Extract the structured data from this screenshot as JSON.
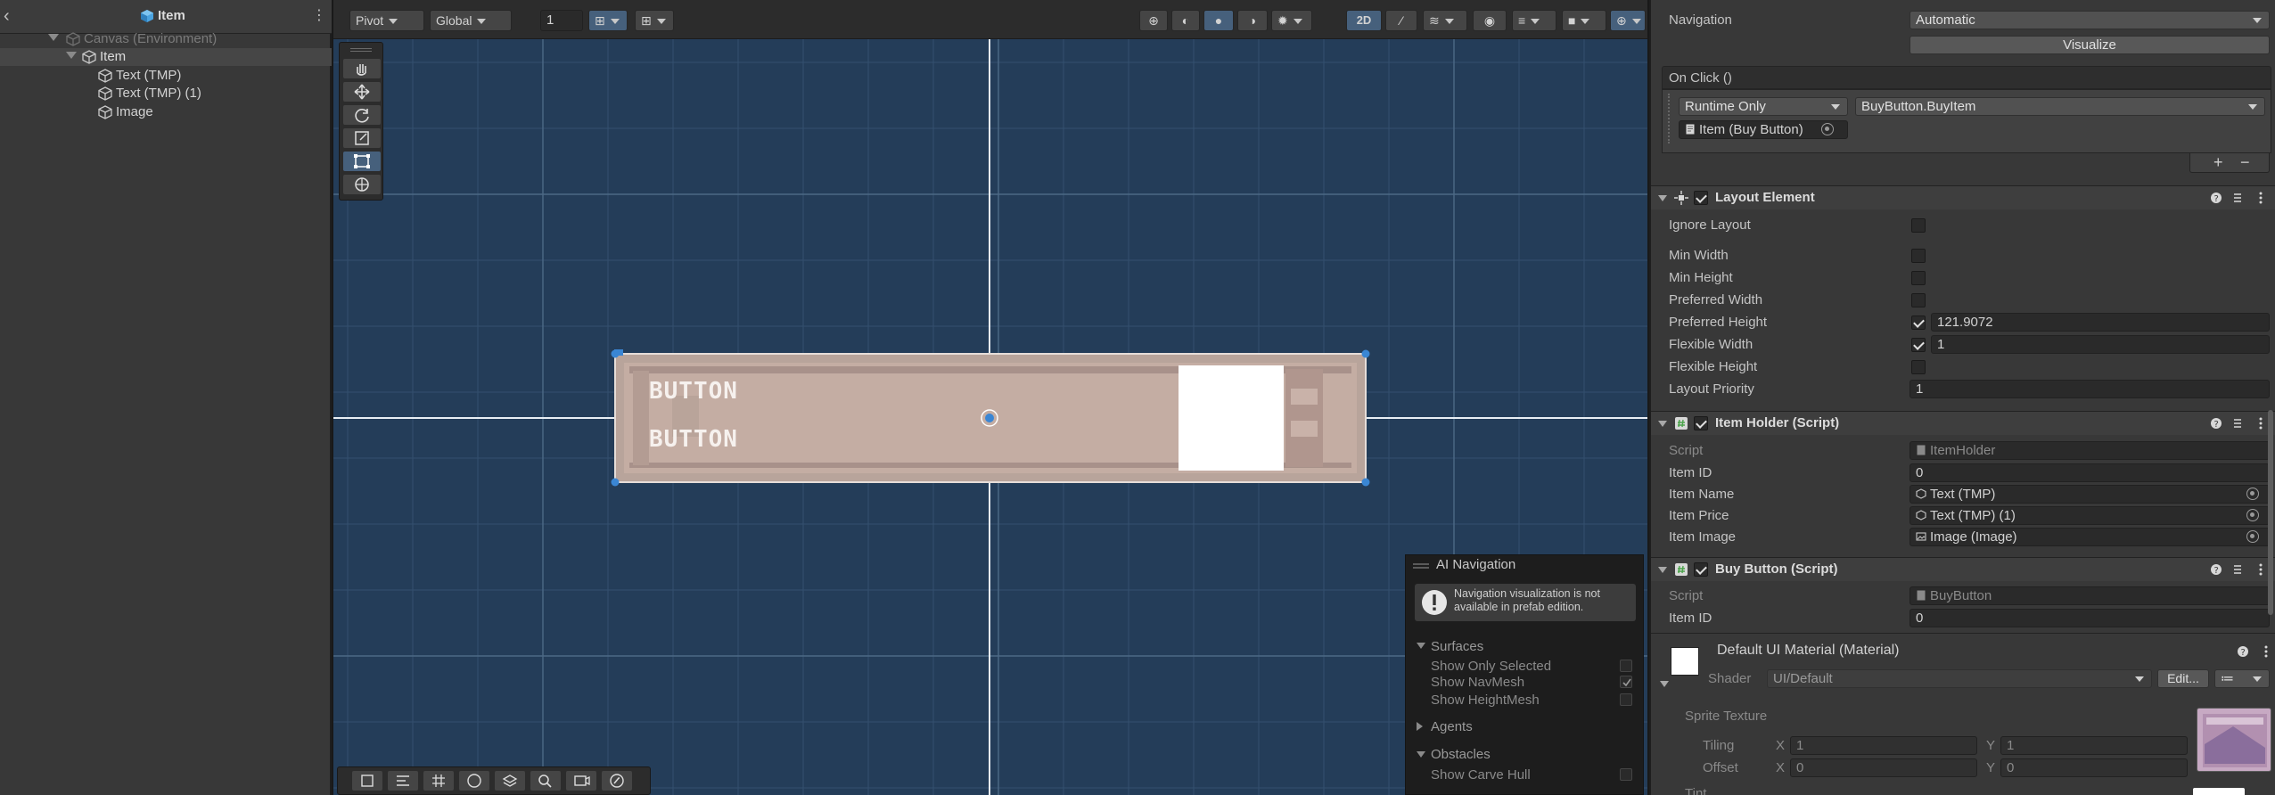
{
  "hierarchy": {
    "title": "Item",
    "items": [
      {
        "label": "Canvas (Environment)",
        "depth": 0,
        "dim": true
      },
      {
        "label": "Item",
        "depth": 1,
        "dim": false,
        "selected": true
      },
      {
        "label": "Text (TMP)",
        "depth": 2,
        "dim": false
      },
      {
        "label": "Text (TMP) (1)",
        "depth": 2,
        "dim": false
      },
      {
        "label": "Image",
        "depth": 2,
        "dim": false
      }
    ]
  },
  "scene_toolbar": {
    "pivot": "Pivot",
    "global": "Global",
    "snap_value": "1",
    "mode_2d": "2D"
  },
  "scene": {
    "button_text_1": "BUTTON",
    "button_text_2": "BUTTON"
  },
  "ai_navigation": {
    "title": "AI Navigation",
    "message": "Navigation visualization is not available in prefab edition.",
    "surfaces": "Surfaces",
    "show_only_selected": "Show Only Selected",
    "show_navmesh": "Show NavMesh",
    "show_heightmesh": "Show HeightMesh",
    "agents": "Agents",
    "obstacles": "Obstacles",
    "show_carve_hull": "Show Carve Hull",
    "show_navmesh_checked": true
  },
  "inspector": {
    "navigation_label": "Navigation",
    "navigation_value": "Automatic",
    "visualize": "Visualize",
    "on_click": "On Click ()",
    "runtime_only": "Runtime Only",
    "function": "BuyButton.BuyItem",
    "target": "Item (Buy Button)",
    "layout_element": {
      "title": "Layout Element",
      "ignore_layout": "Ignore Layout",
      "min_width": "Min Width",
      "min_height": "Min Height",
      "preferred_width": "Preferred Width",
      "preferred_height": "Preferred Height",
      "preferred_height_value": "121.9072",
      "flexible_width": "Flexible Width",
      "flexible_width_value": "1",
      "flexible_height": "Flexible Height",
      "layout_priority": "Layout Priority",
      "layout_priority_value": "1"
    },
    "item_holder": {
      "title": "Item Holder (Script)",
      "script_label": "Script",
      "script_value": "ItemHolder",
      "item_id_label": "Item ID",
      "item_id_value": "0",
      "item_name_label": "Item Name",
      "item_name_value": "Text (TMP)",
      "item_price_label": "Item Price",
      "item_price_value": "Text (TMP) (1)",
      "item_image_label": "Item Image",
      "item_image_value": "Image (Image)"
    },
    "buy_button": {
      "title": "Buy Button (Script)",
      "script_label": "Script",
      "script_value": "BuyButton",
      "item_id_label": "Item ID",
      "item_id_value": "0"
    },
    "material": {
      "title": "Default UI Material (Material)",
      "shader_label": "Shader",
      "shader_value": "UI/Default",
      "edit": "Edit...",
      "sprite_texture": "Sprite Texture",
      "tiling": "Tiling",
      "offset": "Offset",
      "x": "X",
      "y": "Y",
      "tiling_x": "1",
      "tiling_y": "1",
      "offset_x": "0",
      "offset_y": "0",
      "tint": "Tint"
    }
  }
}
